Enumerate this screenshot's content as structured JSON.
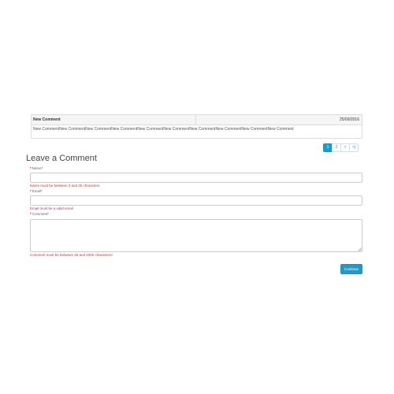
{
  "review": {
    "author": "New Comment",
    "date": "25/09/2016",
    "text": "New CommentNew CommentNew CommentNew CommentNew CommentNew CommentNew CommentNew CommentNew CommentNew Comment"
  },
  "pagination": {
    "pages": [
      "1",
      "2",
      ">",
      ">|"
    ],
    "active": "1"
  },
  "form": {
    "heading": "Leave a Comment",
    "required_mark": "*",
    "name_label": "Name*",
    "name_value": "",
    "name_error": "Name must be between 3 and 25 characters",
    "email_label": "Email*",
    "email_value": "",
    "email_error": "Email must be a valid email",
    "comment_label": "Comment*",
    "comment_value": "",
    "comment_error": "Comment must be between 25 and 1000 characters!",
    "continue_label": "Continue"
  },
  "colors": {
    "accent": "#229ac8",
    "required": "#f00000",
    "error": "#a94442"
  }
}
